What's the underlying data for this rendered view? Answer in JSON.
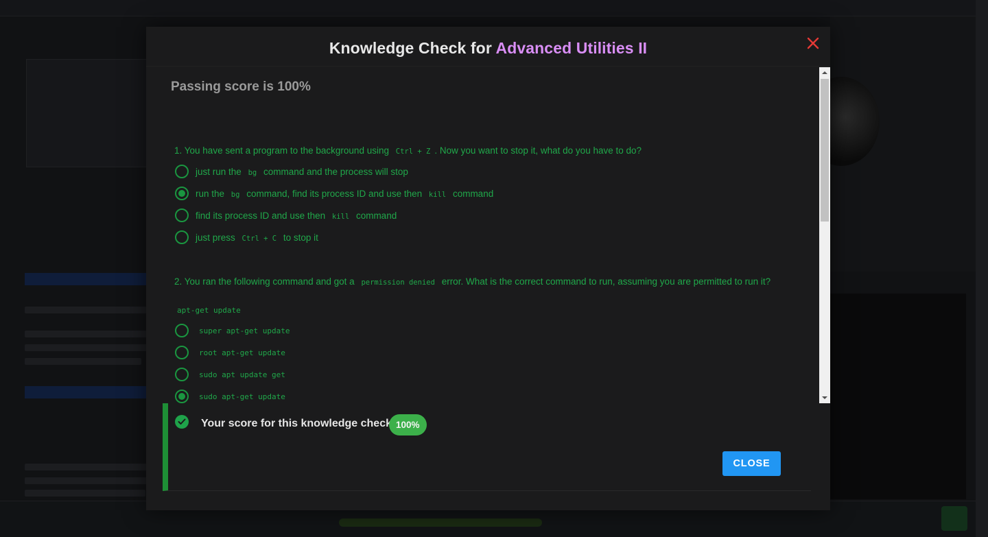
{
  "modal": {
    "title_prefix": "Knowledge Check for ",
    "title_accent": "Advanced Utilities II",
    "passing_score": "Passing score is 100%"
  },
  "questions": [
    {
      "text_parts": [
        "1. You have sent a program to the background using",
        "Ctrl + Z",
        ". Now you want to stop it, what do you have to do?"
      ],
      "options": [
        {
          "parts": [
            "just run the",
            "bg",
            "command and the process will stop"
          ],
          "selected": false
        },
        {
          "parts": [
            "run the",
            "bg",
            "command, find its process ID and use then",
            "kill",
            "command"
          ],
          "selected": true
        },
        {
          "parts": [
            "find its process ID and use then",
            "kill",
            "command"
          ],
          "selected": false
        },
        {
          "parts": [
            "just press",
            "Ctrl + C",
            "to stop it"
          ],
          "selected": false
        }
      ]
    },
    {
      "text_parts": [
        "2. You ran the following command and got a",
        "permission denied",
        "error. What is the correct command to run, assuming you are permitted to run it?"
      ],
      "command": "apt-get update",
      "options": [
        {
          "label": "super apt-get update",
          "selected": false
        },
        {
          "label": "root apt-get update",
          "selected": false
        },
        {
          "label": "sudo apt update get",
          "selected": false
        },
        {
          "label": "sudo apt-get update",
          "selected": true
        }
      ]
    }
  ],
  "result": {
    "score_label": "Your score for this knowledge check:",
    "score_value": "100%",
    "close_button": "CLOSE"
  },
  "colors": {
    "accent_title": "#d98ef5",
    "answer_green": "#20a84a",
    "close_x_red": "#e53935",
    "close_button_blue": "#2196f3",
    "score_badge_green": "#3cb04a"
  },
  "icons": [
    "close-icon",
    "check-circle-icon",
    "scroll-up-arrow-icon",
    "scroll-down-arrow-icon"
  ]
}
